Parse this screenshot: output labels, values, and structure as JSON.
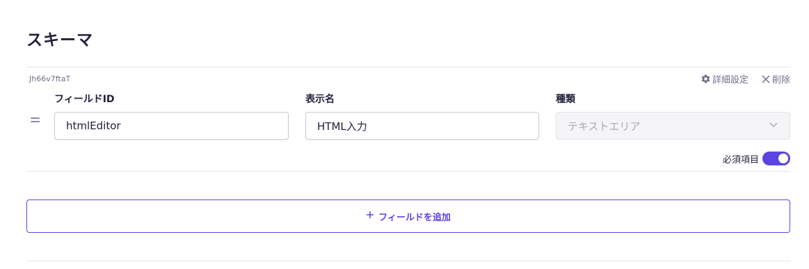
{
  "page": {
    "title": "スキーマ"
  },
  "field": {
    "hash_id": "Jh66v7ftaT",
    "actions": {
      "details_label": "詳細設定",
      "delete_label": "削除"
    },
    "field_id": {
      "label": "フィールドID",
      "value": "htmlEditor"
    },
    "display_name": {
      "label": "表示名",
      "value": "HTML入力"
    },
    "kind": {
      "label": "種類",
      "value": "テキストエリア"
    },
    "required": {
      "label": "必須項目",
      "on": true
    }
  },
  "add_field": {
    "icon": "+",
    "label": "フィールドを追加"
  },
  "colors": {
    "accent": "#5b45e0",
    "text": "#21213b",
    "muted": "#6f6f8c",
    "border": "#e5e5f2"
  },
  "icons": [
    "gear-icon",
    "close-icon",
    "drag-handle-icon",
    "chevron-down-icon",
    "plus-icon"
  ]
}
